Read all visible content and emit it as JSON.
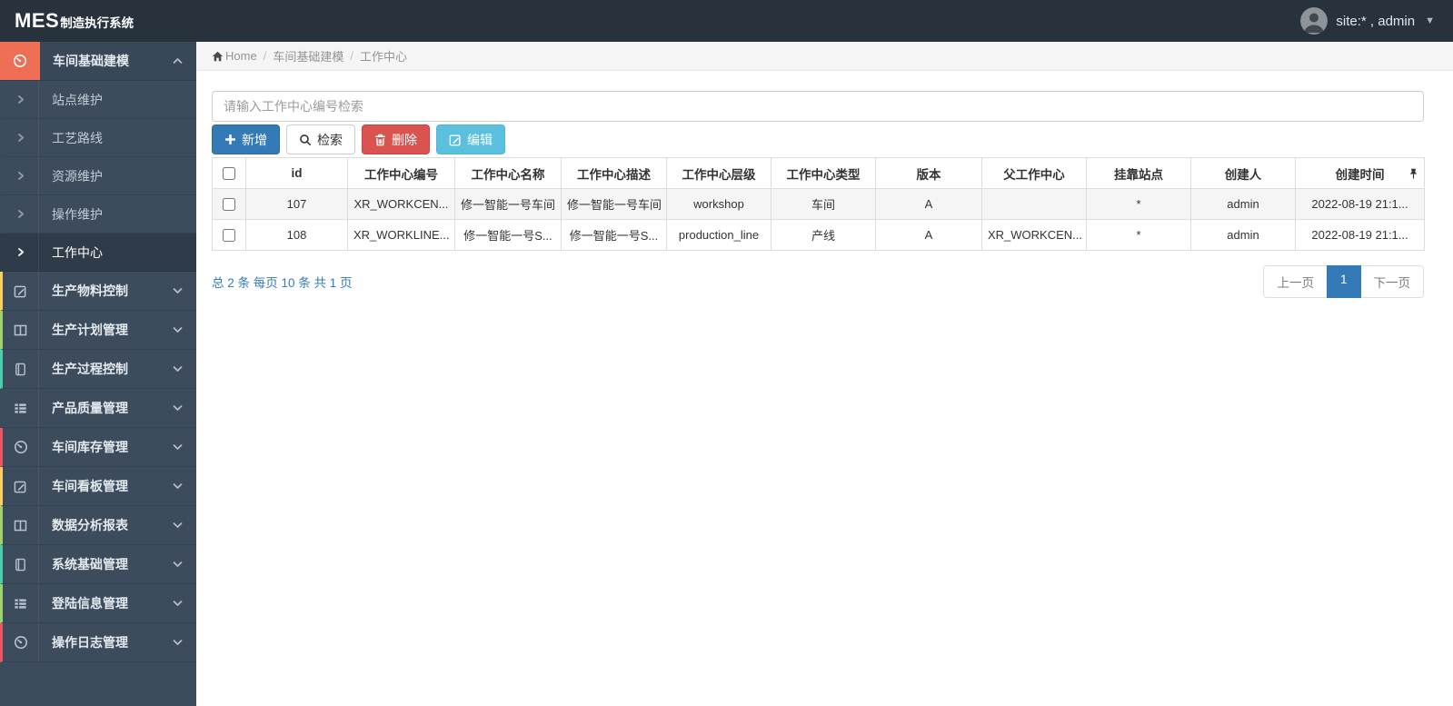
{
  "navbar": {
    "logo_primary": "MES",
    "logo_secondary": "制造执行系统",
    "user": "site:* , admin",
    "avatar_icon": "user-avatar",
    "caret_icon": "caret-down-icon"
  },
  "breadcrumb": {
    "home_icon": "home-icon",
    "home": "Home",
    "separator": "/",
    "items": [
      "车间基础建模",
      "工作中心"
    ]
  },
  "sidebar": {
    "items": [
      {
        "type": "group",
        "label": "车间基础建模",
        "icon": "gauge-icon",
        "icon_block": true,
        "chevron": "up",
        "active": true
      },
      {
        "type": "sub",
        "label": "站点维护",
        "active": false
      },
      {
        "type": "sub",
        "label": "工艺路线",
        "active": false
      },
      {
        "type": "sub",
        "label": "资源维护",
        "active": false
      },
      {
        "type": "sub",
        "label": "操作维护",
        "active": false
      },
      {
        "type": "sub",
        "label": "工作中心",
        "active": true
      },
      {
        "type": "group",
        "label": "生产物料控制",
        "icon": "edit-icon",
        "chevron": "down",
        "stripe": "#fcd05e"
      },
      {
        "type": "group",
        "label": "生产计划管理",
        "icon": "columns-icon",
        "chevron": "down",
        "stripe": "#9ed36a"
      },
      {
        "type": "group",
        "label": "生产过程控制",
        "icon": "book-icon",
        "chevron": "down",
        "stripe": "#48cfad"
      },
      {
        "type": "group",
        "label": "产品质量管理",
        "icon": "list-icon",
        "chevron": "down",
        "stripe": ""
      },
      {
        "type": "group",
        "label": "车间库存管理",
        "icon": "gauge-icon",
        "chevron": "down",
        "stripe": "#ed5565"
      },
      {
        "type": "group",
        "label": "车间看板管理",
        "icon": "edit-icon",
        "chevron": "down",
        "stripe": "#fcd05e"
      },
      {
        "type": "group",
        "label": "数据分析报表",
        "icon": "columns-icon",
        "chevron": "down",
        "stripe": "#9ed36a"
      },
      {
        "type": "group",
        "label": "系统基础管理",
        "icon": "book-icon",
        "chevron": "down",
        "stripe": "#48cfad"
      },
      {
        "type": "group",
        "label": "登陆信息管理",
        "icon": "list-icon",
        "chevron": "down",
        "stripe": "#9ed36a"
      },
      {
        "type": "group",
        "label": "操作日志管理",
        "icon": "gauge-icon",
        "chevron": "down",
        "stripe": "#ed5565"
      }
    ]
  },
  "search": {
    "placeholder": "请输入工作中心编号检索",
    "value": ""
  },
  "toolbar": {
    "add_label": "新增",
    "search_label": "检索",
    "delete_label": "删除",
    "edit_label": "编辑"
  },
  "table": {
    "columns": [
      "id",
      "工作中心编号",
      "工作中心名称",
      "工作中心描述",
      "工作中心层级",
      "工作中心类型",
      "版本",
      "父工作中心",
      "挂靠站点",
      "创建人",
      "创建时间"
    ],
    "pin_icon": "pin-icon",
    "rows": [
      {
        "checked": false,
        "cells": [
          "107",
          "XR_WORKCEN...",
          "修一智能一号车间",
          "修一智能一号车间",
          "workshop",
          "车间",
          "A",
          "",
          "*",
          "admin",
          "2022-08-19 21:1..."
        ]
      },
      {
        "checked": false,
        "cells": [
          "108",
          "XR_WORKLINE...",
          "修一智能一号S...",
          "修一智能一号S...",
          "production_line",
          "产线",
          "A",
          "XR_WORKCEN...",
          "*",
          "admin",
          "2022-08-19 21:1..."
        ]
      }
    ]
  },
  "pagination": {
    "summary": "总 2 条 每页 10 条 共 1 页",
    "prev": "上一页",
    "current": "1",
    "next": "下一页"
  },
  "colors": {
    "navbar_bg": "#28323d",
    "sidebar_bg": "#3d4c5c",
    "active_sub_bg": "#2f3b48",
    "group_icon_block": "#ee6f56",
    "primary": "#337ab7",
    "danger": "#d9534f",
    "info": "#5bc0de",
    "stripe_yellow": "#fcd05e",
    "stripe_green": "#9ed36a",
    "stripe_teal": "#48cfad",
    "stripe_red": "#ed5565"
  }
}
